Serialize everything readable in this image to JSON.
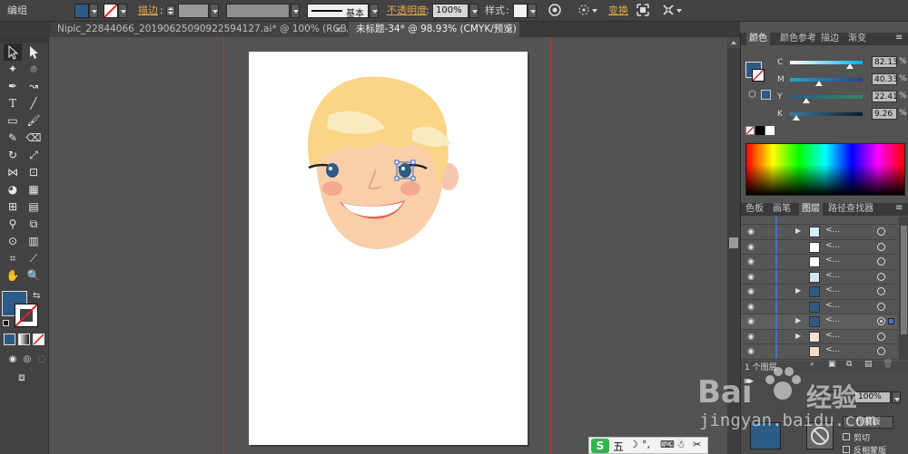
{
  "controlbar": {
    "selection_label": "编组",
    "stroke_label": "描边",
    "stroke_style": "基本",
    "opacity_label": "不透明度",
    "opacity_value": "100%",
    "style_label": "样式",
    "transform_label": "变换",
    "fill_color": "#2d5b86"
  },
  "tabs": [
    {
      "label": "Nipic_22844066_20190625090922594127.ai* @ 100% (RGB/预览)",
      "close": "×"
    },
    {
      "label": "未标题-34* @ 98.93% (CMYK/预览)",
      "close": "×"
    }
  ],
  "color_panel": {
    "tabs": [
      "颜色",
      "颜色参考",
      "描边",
      "渐变"
    ],
    "sliders": [
      {
        "label": "C",
        "value": "82.13",
        "unit": "%",
        "level": 0.82,
        "colors": [
          "#ffffff",
          "#00aeef"
        ]
      },
      {
        "label": "M",
        "value": "40.33",
        "unit": "%",
        "level": 0.4,
        "colors": [
          "#1fa6c9",
          "#2a3f8f"
        ]
      },
      {
        "label": "Y",
        "value": "22.41",
        "unit": "%",
        "level": 0.22,
        "colors": [
          "#2d5b86",
          "#2f8a5c"
        ]
      },
      {
        "label": "K",
        "value": "9.26",
        "unit": "%",
        "level": 0.09,
        "colors": [
          "#3a79a8",
          "#0d1f2a"
        ]
      }
    ],
    "fill_color": "#2d5b86"
  },
  "layers_panel": {
    "tabs": [
      "色板",
      "画笔",
      "图层",
      "路径查找器"
    ],
    "rows": [
      {
        "name": "<...",
        "expand": true,
        "thumb": "#d6ecf2",
        "selected": false
      },
      {
        "name": "<...",
        "expand": false,
        "thumb": "#ffffff",
        "selected": false
      },
      {
        "name": "<...",
        "expand": false,
        "thumb": "#ffffff",
        "selected": false
      },
      {
        "name": "<...",
        "expand": false,
        "thumb": "#d6e6f0",
        "selected": false
      },
      {
        "name": "<...",
        "expand": true,
        "thumb": "#2d5b86",
        "selected": false
      },
      {
        "name": "<...",
        "expand": false,
        "thumb": "#2d5b86",
        "selected": false
      },
      {
        "name": "<...",
        "expand": true,
        "thumb": "#2d5b86",
        "selected": true
      },
      {
        "name": "<...",
        "expand": true,
        "thumb": "#fbe0d6",
        "selected": false
      },
      {
        "name": "<...",
        "expand": false,
        "thumb": "#f7d9c8",
        "selected": false
      }
    ],
    "footer_count": "1 个图层"
  },
  "bottom_panel": {
    "opacity_value": "100%",
    "mask_button": "作蒙版",
    "clip_label": "剪切",
    "invert_label": "反相蒙版"
  },
  "watermark": {
    "logo": "Bai",
    "logo_cn": "经验",
    "url": "jingyan.baidu.com"
  },
  "ime": {
    "label": "五"
  }
}
